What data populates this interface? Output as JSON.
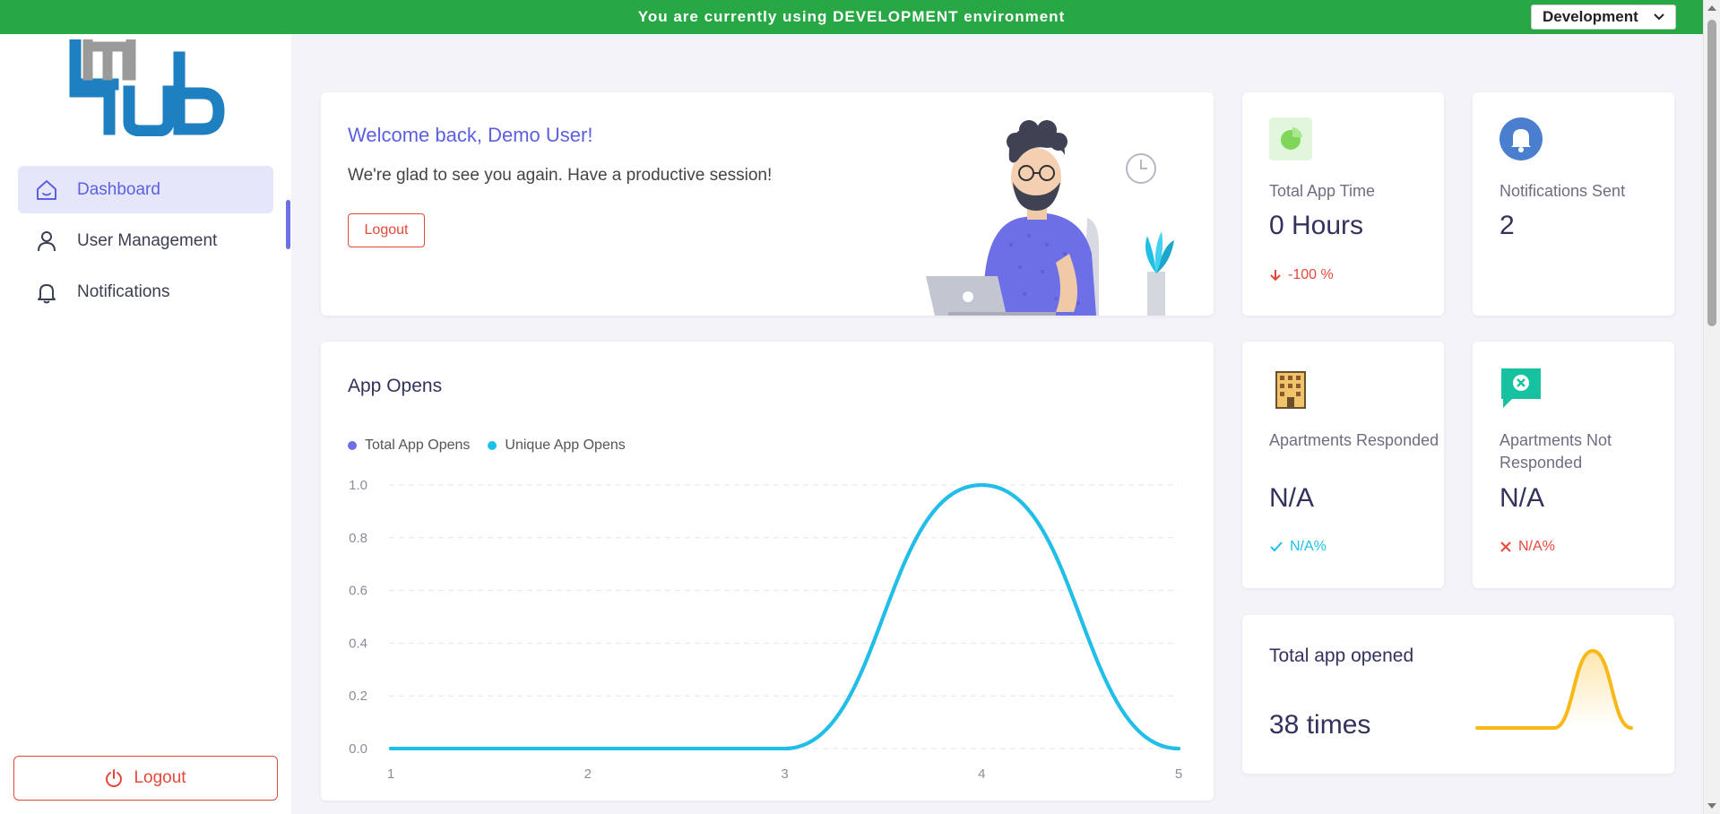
{
  "env_banner": {
    "message": "You are currently using DEVELOPMENT environment",
    "selected_env": "Development"
  },
  "sidebar": {
    "items": [
      {
        "label": "Dashboard",
        "icon": "home-icon",
        "active": true
      },
      {
        "label": "User Management",
        "icon": "user-icon",
        "active": false
      },
      {
        "label": "Notifications",
        "icon": "bell-icon",
        "active": false
      }
    ],
    "logout_label": "Logout"
  },
  "welcome": {
    "title": "Welcome back, Demo User!",
    "message": "We're glad to see you again. Have a productive session!",
    "logout_label": "Logout"
  },
  "stats": {
    "total_app_time": {
      "label": "Total App Time",
      "value": "0 Hours",
      "delta": "-100 %",
      "icon": "pie-chart-icon"
    },
    "notifications_sent": {
      "label": "Notifications Sent",
      "value": "2",
      "icon": "bell-icon"
    },
    "apartments_responded": {
      "label": "Apartments Responded",
      "value": "N/A",
      "delta": "N/A%",
      "icon": "building-icon"
    },
    "apartments_not_responded": {
      "label": "Apartments Not Responded",
      "value": "N/A",
      "delta": "N/A%",
      "icon": "chat-x-icon"
    }
  },
  "total_opened": {
    "title": "Total app opened",
    "value": "38 times"
  },
  "colors": {
    "accent": "#5c5fe0",
    "env_bar": "#28a745",
    "danger": "#e5483a",
    "total_series": "#6c6fe6",
    "unique_series": "#1ec0e8",
    "mini_line": "#f8b918"
  },
  "chart_data": {
    "type": "line",
    "title": "App Opens",
    "x": [
      1,
      2,
      3,
      4,
      5
    ],
    "series": [
      {
        "name": "Total App Opens",
        "values": [
          0,
          0,
          0,
          1,
          0
        ]
      },
      {
        "name": "Unique App Opens",
        "values": [
          0,
          0,
          0,
          1,
          0
        ]
      }
    ],
    "ylim": [
      0,
      1
    ],
    "yticks": [
      "0.0",
      "0.2",
      "0.4",
      "0.6",
      "0.8",
      "1.0"
    ],
    "xticks": [
      "1",
      "2",
      "3",
      "4",
      "5"
    ],
    "grid": true,
    "legend": "top-left"
  },
  "mini_chart_data": {
    "type": "line",
    "x": [
      1,
      2,
      3,
      4,
      5
    ],
    "values": [
      0,
      0,
      0,
      1,
      0
    ]
  }
}
